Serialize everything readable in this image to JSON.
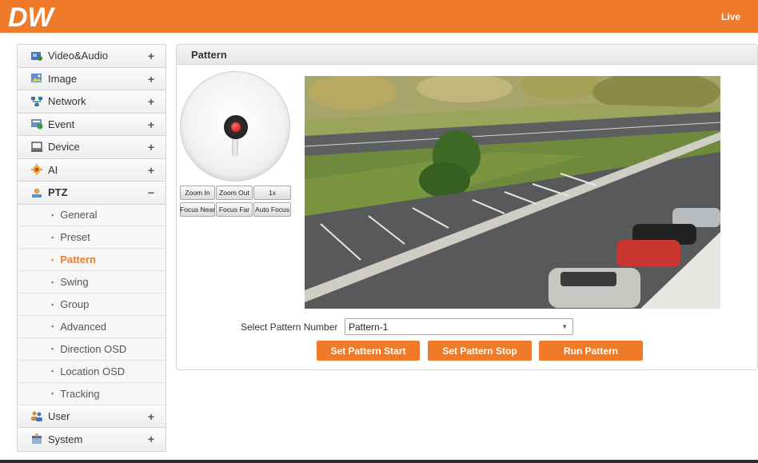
{
  "header": {
    "logo_text": "DW",
    "live_label": "Live",
    "accent_color": "#ee7a2a"
  },
  "sidebar": {
    "menus": [
      {
        "label": "Video&Audio",
        "icon": "video-audio-icon",
        "toggle": "+"
      },
      {
        "label": "Image",
        "icon": "image-icon",
        "toggle": "+"
      },
      {
        "label": "Network",
        "icon": "network-icon",
        "toggle": "+"
      },
      {
        "label": "Event",
        "icon": "event-icon",
        "toggle": "+"
      },
      {
        "label": "Device",
        "icon": "device-icon",
        "toggle": "+"
      },
      {
        "label": "AI",
        "icon": "ai-icon",
        "toggle": "+"
      },
      {
        "label": "PTZ",
        "icon": "ptz-icon",
        "toggle": "−"
      }
    ],
    "ptz_submenu": [
      "General",
      "Preset",
      "Pattern",
      "Swing",
      "Group",
      "Advanced",
      "Direction OSD",
      "Location OSD",
      "Tracking"
    ],
    "selected_submenu": "Pattern",
    "bottom_menus": [
      {
        "label": "User",
        "icon": "user-icon",
        "toggle": "+"
      },
      {
        "label": "System",
        "icon": "system-icon",
        "toggle": "+"
      }
    ]
  },
  "panel": {
    "title": "Pattern",
    "ptz_controls": {
      "row1": [
        "Zoom In",
        "Zoom Out",
        "1x"
      ],
      "row2": [
        "Focus Near",
        "Focus Far",
        "Auto Focus"
      ]
    },
    "select_label": "Select Pattern Number",
    "select_value": "Pattern-1",
    "buttons": {
      "start": "Set Pattern Start",
      "stop": "Set Pattern Stop",
      "run": "Run Pattern"
    }
  }
}
